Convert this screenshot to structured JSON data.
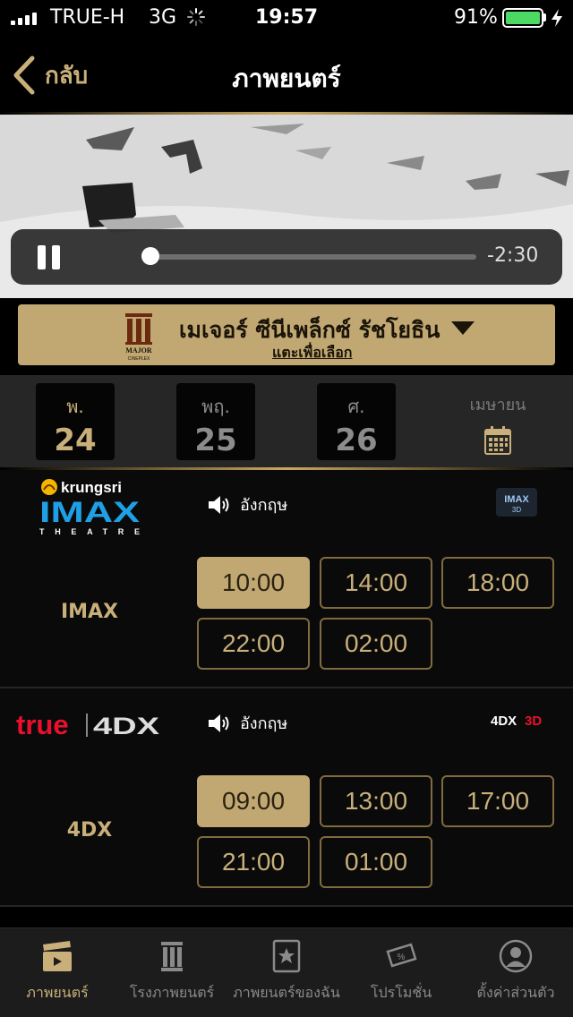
{
  "status": {
    "carrier": "TRUE-H",
    "network": "3G",
    "time": "19:57",
    "battery": "91%"
  },
  "nav": {
    "back_label": "กลับ",
    "title": "ภาพยนตร์"
  },
  "video": {
    "time_remaining": "-2:30"
  },
  "cinema": {
    "logo_text_top": "MAJOR",
    "logo_text_bottom": "CINEPLEX",
    "name": "เมเจอร์ ซีนีเพล็กซ์ รัชโยธิน",
    "hint": "แตะเพื่อเลือก"
  },
  "dates": [
    {
      "day": "พ.",
      "num": "24",
      "active": true
    },
    {
      "day": "พฤ.",
      "num": "25",
      "active": false
    },
    {
      "day": "ศ.",
      "num": "26",
      "active": false
    }
  ],
  "month_label": "เมษายน",
  "sections": [
    {
      "sponsor_top": "krungsri",
      "sponsor_brand": "IMAX",
      "sponsor_sub": "THEATRE",
      "language": "อังกฤษ",
      "format": "IMAX",
      "badge_top": "IMAX",
      "badge_bottom": "3D",
      "times": [
        "10:00",
        "14:00",
        "18:00",
        "22:00",
        "02:00"
      ]
    },
    {
      "sponsor_top": "true",
      "sponsor_brand": "4DX",
      "language": "อังกฤษ",
      "format": "4DX",
      "badge_top": "4DX",
      "badge_bottom": "3D",
      "times": [
        "09:00",
        "13:00",
        "17:00",
        "21:00",
        "01:00"
      ]
    }
  ],
  "tabs": [
    {
      "label": "ภาพยนตร์",
      "icon": "clapperboard-icon",
      "active": true
    },
    {
      "label": "โรงภาพยนตร์",
      "icon": "cinema-building-icon",
      "active": false
    },
    {
      "label": "ภาพยนตร์ของฉัน",
      "icon": "my-movies-icon",
      "active": false
    },
    {
      "label": "โปรโมชั่น",
      "icon": "promotion-tag-icon",
      "active": false
    },
    {
      "label": "ตั้งค่าส่วนตัว",
      "icon": "profile-icon",
      "active": false
    }
  ],
  "colors": {
    "gold": "#c9b07a",
    "gold_fill": "#c1a873",
    "battery": "#4cd964",
    "krungsri_yellow": "#f5b400",
    "imax_blue": "#1fa0e6",
    "true_red": "#e8112d"
  }
}
